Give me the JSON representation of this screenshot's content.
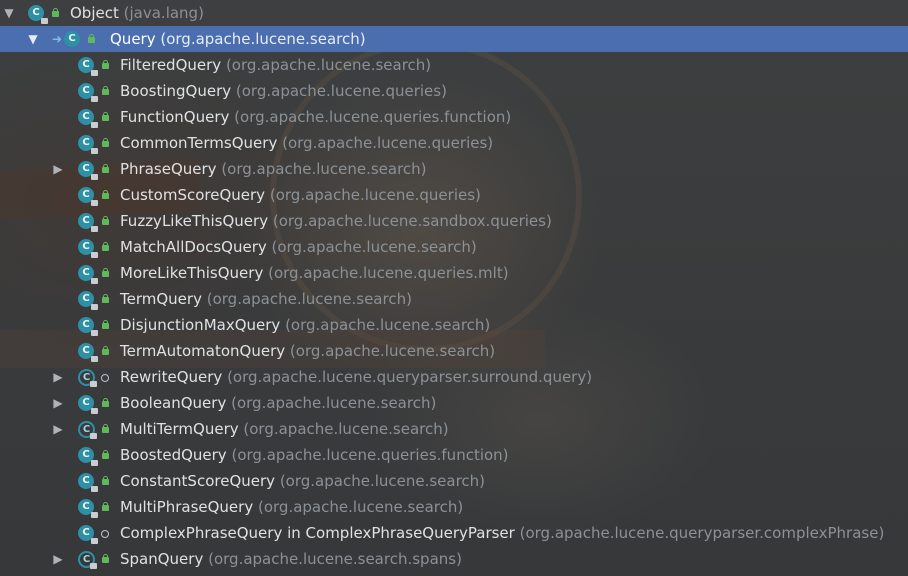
{
  "hierarchy": {
    "root": {
      "name": "Object",
      "package": "(java.lang)"
    },
    "selected": {
      "name": "Query",
      "package": "(org.apache.lucene.search)"
    },
    "children": [
      {
        "name": "FilteredQuery",
        "package": "(org.apache.lucene.search)",
        "expandable": false,
        "visibility": "public"
      },
      {
        "name": "BoostingQuery",
        "package": "(org.apache.lucene.queries)",
        "expandable": false,
        "visibility": "public"
      },
      {
        "name": "FunctionQuery",
        "package": "(org.apache.lucene.queries.function)",
        "expandable": false,
        "visibility": "public"
      },
      {
        "name": "CommonTermsQuery",
        "package": "(org.apache.lucene.queries)",
        "expandable": false,
        "visibility": "public"
      },
      {
        "name": "PhraseQuery",
        "package": "(org.apache.lucene.search)",
        "expandable": true,
        "visibility": "public"
      },
      {
        "name": "CustomScoreQuery",
        "package": "(org.apache.lucene.queries)",
        "expandable": false,
        "visibility": "public"
      },
      {
        "name": "FuzzyLikeThisQuery",
        "package": "(org.apache.lucene.sandbox.queries)",
        "expandable": false,
        "visibility": "public"
      },
      {
        "name": "MatchAllDocsQuery",
        "package": "(org.apache.lucene.search)",
        "expandable": false,
        "visibility": "public"
      },
      {
        "name": "MoreLikeThisQuery",
        "package": "(org.apache.lucene.queries.mlt)",
        "expandable": false,
        "visibility": "public"
      },
      {
        "name": "TermQuery",
        "package": "(org.apache.lucene.search)",
        "expandable": false,
        "visibility": "public"
      },
      {
        "name": "DisjunctionMaxQuery",
        "package": "(org.apache.lucene.search)",
        "expandable": false,
        "visibility": "public"
      },
      {
        "name": "TermAutomatonQuery",
        "package": "(org.apache.lucene.search)",
        "expandable": false,
        "visibility": "public"
      },
      {
        "name": "RewriteQuery",
        "package": "(org.apache.lucene.queryparser.surround.query)",
        "expandable": true,
        "visibility": "package",
        "abstract": true
      },
      {
        "name": "BooleanQuery",
        "package": "(org.apache.lucene.search)",
        "expandable": true,
        "visibility": "public"
      },
      {
        "name": "MultiTermQuery",
        "package": "(org.apache.lucene.search)",
        "expandable": true,
        "visibility": "public",
        "abstract": true
      },
      {
        "name": "BoostedQuery",
        "package": "(org.apache.lucene.queries.function)",
        "expandable": false,
        "visibility": "public"
      },
      {
        "name": "ConstantScoreQuery",
        "package": "(org.apache.lucene.search)",
        "expandable": false,
        "visibility": "public"
      },
      {
        "name": "MultiPhraseQuery",
        "package": "(org.apache.lucene.search)",
        "expandable": false,
        "visibility": "public"
      },
      {
        "name": "ComplexPhraseQuery in ComplexPhraseQueryParser",
        "package": "(org.apache.lucene.queryparser.complexPhrase)",
        "expandable": false,
        "visibility": "package"
      },
      {
        "name": "SpanQuery",
        "package": "(org.apache.lucene.search.spans)",
        "expandable": true,
        "visibility": "public",
        "abstract": true
      }
    ]
  },
  "icons": {
    "expanded": "▼",
    "collapsed": "▶",
    "class_letter": "C"
  },
  "colors": {
    "selection": "#4b6eaf",
    "class_icon": "#2f8fa5",
    "public_lock": "#5fb85c"
  }
}
